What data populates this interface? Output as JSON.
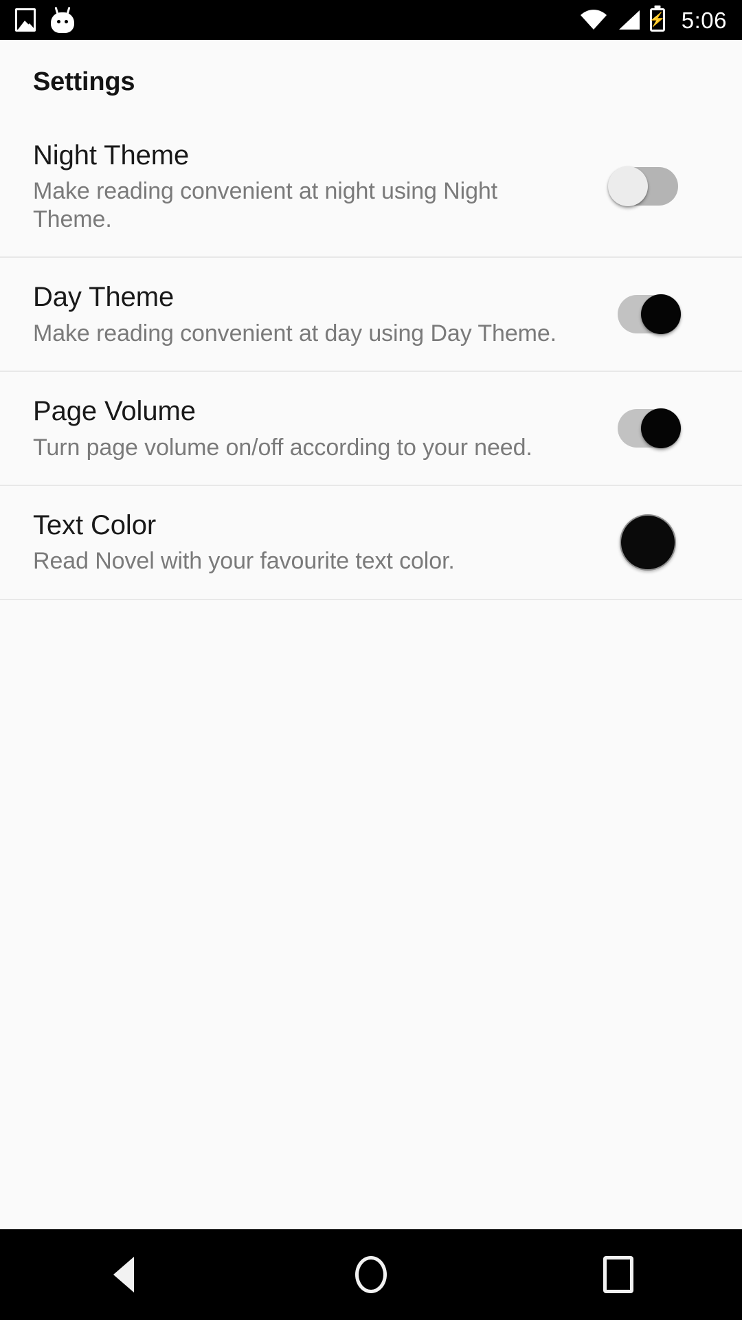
{
  "status_bar": {
    "icons_left": [
      "photo-icon",
      "android-mascot-icon"
    ],
    "icons_right": [
      "wifi-icon",
      "cellular-signal-icon",
      "battery-charging-icon"
    ],
    "time": "5:06"
  },
  "header": {
    "title": "Settings"
  },
  "settings": [
    {
      "title": "Night Theme",
      "description": "Make reading convenient at night using Night Theme.",
      "control": "switch",
      "state": "off"
    },
    {
      "title": "Day Theme",
      "description": "Make reading convenient at day using Day Theme.",
      "control": "switch",
      "state": "on"
    },
    {
      "title": "Page Volume",
      "description": "Turn page volume on/off according to your need.",
      "control": "switch",
      "state": "on"
    },
    {
      "title": "Text Color",
      "description": "Read Novel with your favourite text color.",
      "control": "color-swatch",
      "color": "#0a0a0a"
    }
  ],
  "nav_bar": {
    "back": "back-icon",
    "home": "home-icon",
    "recents": "recents-icon"
  },
  "colors": {
    "background": "#fafafa",
    "title_text": "#191919",
    "description_text": "#7a7a7a",
    "divider": "#e8e8e8",
    "switch_on_thumb": "#050505",
    "switch_off_thumb": "#ececec",
    "system_bar": "#000000"
  }
}
